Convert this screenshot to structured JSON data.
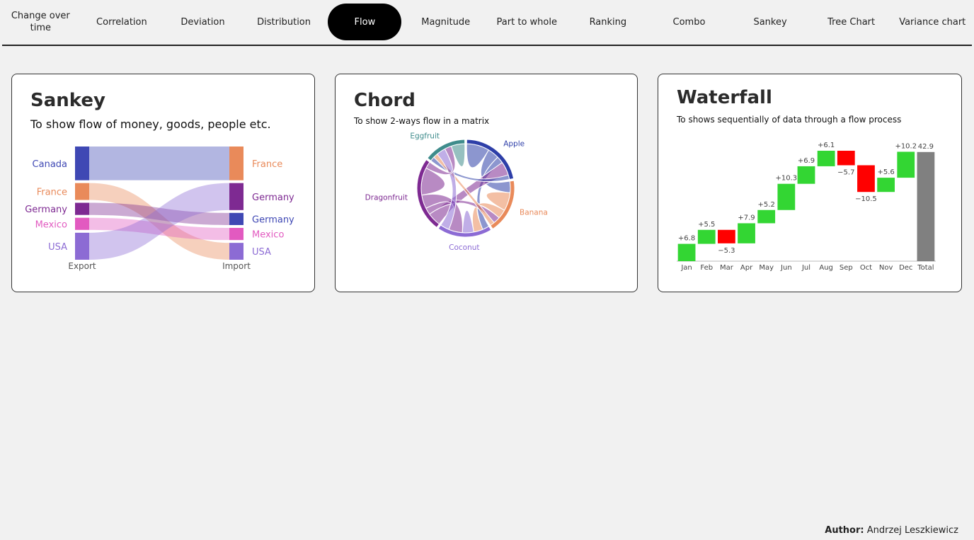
{
  "nav": {
    "items": [
      {
        "label": "Change over time",
        "lines": [
          "Change over",
          "time"
        ],
        "name": "change-over-time"
      },
      {
        "label": "Correlation",
        "lines": [
          "Correlation"
        ],
        "name": "correlation"
      },
      {
        "label": "Deviation",
        "lines": [
          "Deviation"
        ],
        "name": "deviation"
      },
      {
        "label": "Distribution",
        "lines": [
          "Distribution"
        ],
        "name": "distribution"
      },
      {
        "label": "Flow",
        "lines": [
          "Flow"
        ],
        "name": "flow",
        "active": true
      },
      {
        "label": "Magnitude",
        "lines": [
          "Magnitude"
        ],
        "name": "magnitude"
      },
      {
        "label": "Part to whole",
        "lines": [
          "Part to whole"
        ],
        "name": "part-to-whole"
      },
      {
        "label": "Ranking",
        "lines": [
          "Ranking"
        ],
        "name": "ranking"
      },
      {
        "label": "Combo",
        "lines": [
          "Combo"
        ],
        "name": "combo"
      },
      {
        "label": "Sankey",
        "lines": [
          "Sankey"
        ],
        "name": "sankey"
      },
      {
        "label": "Tree Chart",
        "lines": [
          "Tree Chart"
        ],
        "name": "tree-chart"
      },
      {
        "label": "Variance chart",
        "lines": [
          "Variance chart"
        ],
        "name": "variance-chart"
      }
    ]
  },
  "cards": {
    "sankey": {
      "title": "Sankey",
      "subtitle": "To show flow of money, goods, people etc."
    },
    "chord": {
      "title": "Chord",
      "subtitle": "To show 2-ways flow in a matrix"
    },
    "waterfall": {
      "title": "Waterfall",
      "subtitle": "To shows sequentially of data through a flow process"
    }
  },
  "footer": {
    "author_label": "Author:",
    "author_name": "Andrzej Leszkiewicz"
  },
  "chart_data": [
    {
      "type": "sankey",
      "columns": [
        "Export",
        "Import"
      ],
      "sources": [
        {
          "name": "Canada",
          "color": "#3f48b4"
        },
        {
          "name": "France",
          "color": "#e98a5a"
        },
        {
          "name": "Germany",
          "color": "#7e2a92"
        },
        {
          "name": "Mexico",
          "color": "#e25ac0"
        },
        {
          "name": "USA",
          "color": "#8c6bd4"
        }
      ],
      "targets": [
        {
          "name": "France",
          "color": "#e98a5a"
        },
        {
          "name": "Germany",
          "color": "#7e2a92"
        },
        {
          "name": "Germany",
          "color": "#3f48b4"
        },
        {
          "name": "Mexico",
          "color": "#e25ac0"
        },
        {
          "name": "USA",
          "color": "#8c6bd4"
        }
      ],
      "flows": [
        {
          "from": 0,
          "to": 0,
          "value": 5
        },
        {
          "from": 1,
          "to": 4,
          "value": 2.5
        },
        {
          "from": 2,
          "to": 2,
          "value": 1.8
        },
        {
          "from": 3,
          "to": 3,
          "value": 1.8
        },
        {
          "from": 4,
          "to": 1,
          "value": 4
        }
      ]
    },
    {
      "type": "chord",
      "groups": [
        {
          "name": "Apple",
          "color": "#2e3fa8"
        },
        {
          "name": "Banana",
          "color": "#e98a5a"
        },
        {
          "name": "Coconut",
          "color": "#8c6bd4"
        },
        {
          "name": "Dragonfruit",
          "color": "#7e2a92"
        },
        {
          "name": "Eggfruit",
          "color": "#3f8c8c"
        }
      ],
      "matrix": [
        [
          10,
          5,
          3,
          6,
          2
        ],
        [
          5,
          8,
          4,
          3,
          2
        ],
        [
          3,
          4,
          5,
          6,
          4
        ],
        [
          6,
          3,
          6,
          12,
          3
        ],
        [
          2,
          2,
          4,
          3,
          6
        ]
      ]
    },
    {
      "type": "waterfall",
      "categories": [
        "Jan",
        "Feb",
        "Mar",
        "Apr",
        "May",
        "Jun",
        "Jul",
        "Aug",
        "Sep",
        "Oct",
        "Nov",
        "Dec",
        "Total"
      ],
      "values": [
        6.8,
        5.5,
        -5.3,
        7.9,
        5.2,
        10.3,
        6.9,
        6.1,
        -5.7,
        -10.5,
        5.6,
        10.2,
        42.9
      ],
      "labels": [
        "+6.8",
        "+5.5",
        "−5.3",
        "+7.9",
        "+5.2",
        "+10.3",
        "+6.9",
        "+6.1",
        "−5.7",
        "−10.5",
        "+5.6",
        "+10.2",
        "42.9"
      ],
      "total_index": 12,
      "colors": {
        "increase": "#33d633",
        "decrease": "#ff0000",
        "total": "#808080"
      }
    }
  ]
}
